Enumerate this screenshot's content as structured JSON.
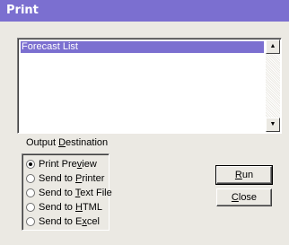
{
  "window": {
    "title": "Print"
  },
  "report_list": {
    "items": [
      "Forecast List"
    ],
    "scroll_up_glyph": "▲",
    "scroll_down_glyph": "▼"
  },
  "output_destination": {
    "label_pre": "Output ",
    "label_ul": "D",
    "label_post": "estination",
    "options": [
      {
        "pre": "Print Pre",
        "ul": "v",
        "post": "iew",
        "selected": true
      },
      {
        "pre": "Send to ",
        "ul": "P",
        "post": "rinter",
        "selected": false
      },
      {
        "pre": "Send to ",
        "ul": "T",
        "post": "ext File",
        "selected": false
      },
      {
        "pre": "Send to ",
        "ul": "H",
        "post": "TML",
        "selected": false
      },
      {
        "pre": "Send to E",
        "ul": "x",
        "post": "cel",
        "selected": false
      }
    ]
  },
  "buttons": {
    "run": {
      "ul": "R",
      "post": "un"
    },
    "close": {
      "ul": "C",
      "post": "lose"
    }
  },
  "colors": {
    "title_bar": "#7b6fd0",
    "selection": "#7b6fd0",
    "window_bg": "#ebe9e3"
  }
}
